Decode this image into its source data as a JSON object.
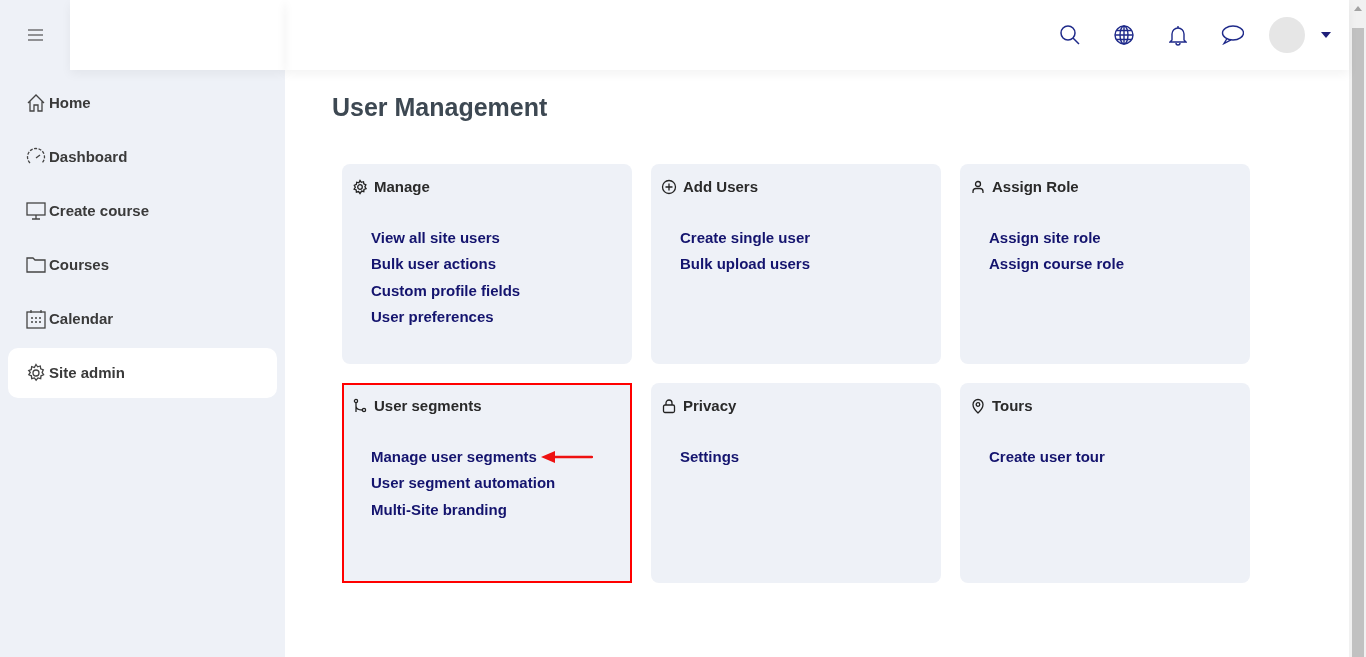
{
  "sidebar": {
    "items": [
      {
        "label": "Home",
        "selected": false
      },
      {
        "label": "Dashboard",
        "selected": false
      },
      {
        "label": "Create course",
        "selected": false
      },
      {
        "label": "Courses",
        "selected": false
      },
      {
        "label": "Calendar",
        "selected": false
      },
      {
        "label": "Site admin",
        "selected": true
      }
    ]
  },
  "page_title": "User Management",
  "cards": [
    {
      "title": "Manage",
      "highlighted": false,
      "links": [
        {
          "label": "View all site users",
          "arrow": false
        },
        {
          "label": "Bulk user actions",
          "arrow": false
        },
        {
          "label": "Custom profile fields",
          "arrow": false
        },
        {
          "label": "User preferences",
          "arrow": false
        }
      ]
    },
    {
      "title": "Add Users",
      "highlighted": false,
      "links": [
        {
          "label": "Create single user",
          "arrow": false
        },
        {
          "label": "Bulk upload users",
          "arrow": false
        }
      ]
    },
    {
      "title": "Assign Role",
      "highlighted": false,
      "links": [
        {
          "label": "Assign site role",
          "arrow": false
        },
        {
          "label": "Assign course role",
          "arrow": false
        }
      ]
    },
    {
      "title": "User segments",
      "highlighted": true,
      "links": [
        {
          "label": "Manage user segments",
          "arrow": true
        },
        {
          "label": "User segment automation",
          "arrow": false
        },
        {
          "label": "Multi-Site branding",
          "arrow": false
        }
      ]
    },
    {
      "title": "Privacy",
      "highlighted": false,
      "links": [
        {
          "label": "Settings",
          "arrow": false
        }
      ]
    },
    {
      "title": "Tours",
      "highlighted": false,
      "links": [
        {
          "label": "Create user tour",
          "arrow": false
        }
      ]
    }
  ]
}
